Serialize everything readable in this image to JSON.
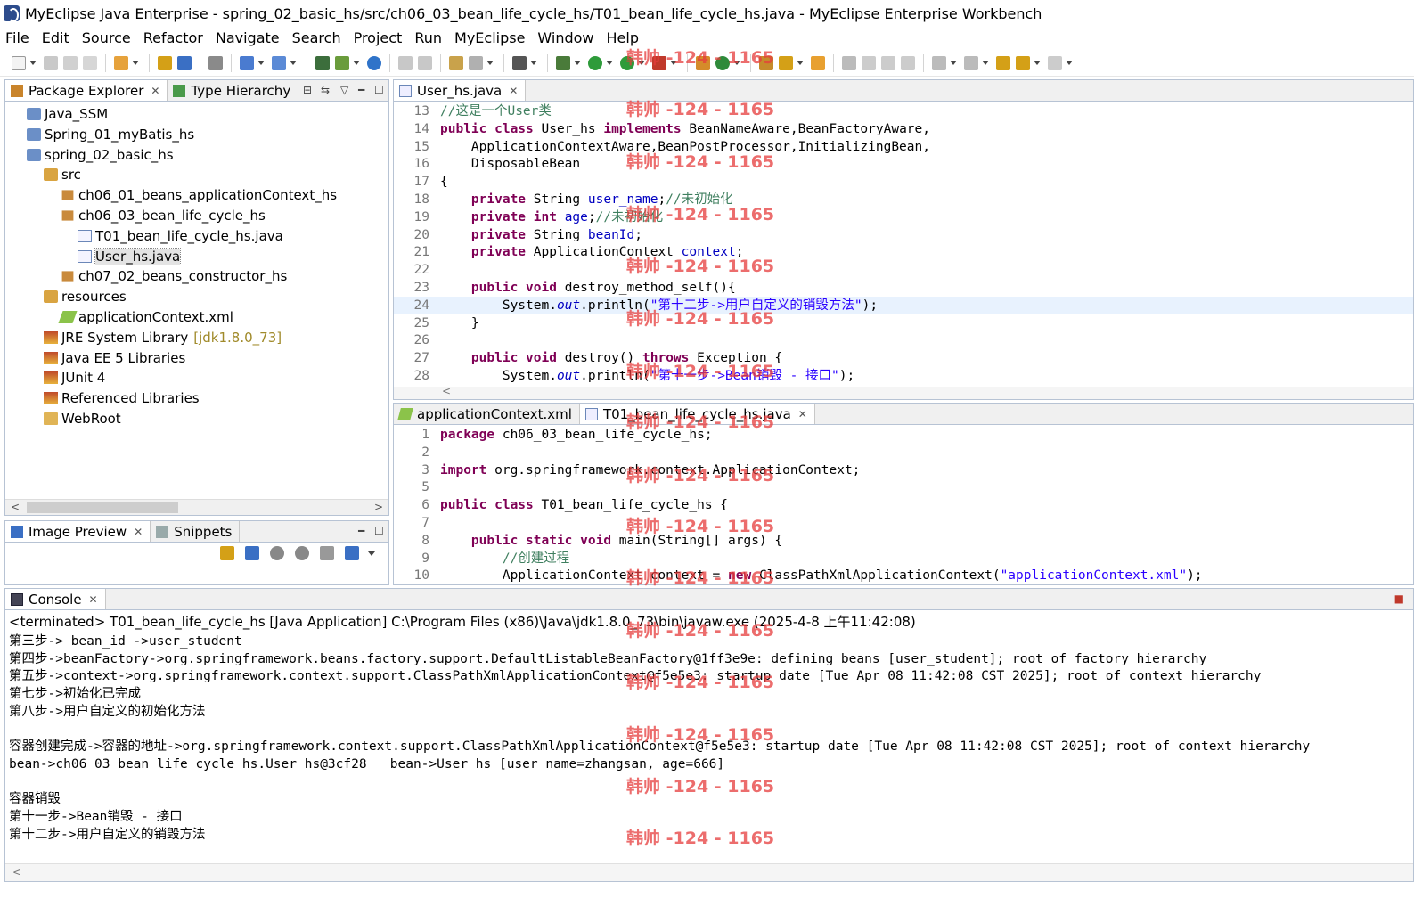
{
  "window": {
    "title": "MyEclipse Java Enterprise - spring_02_basic_hs/src/ch06_03_bean_life_cycle_hs/T01_bean_life_cycle_hs.java - MyEclipse Enterprise Workbench"
  },
  "menu": [
    "File",
    "Edit",
    "Source",
    "Refactor",
    "Navigate",
    "Search",
    "Project",
    "Run",
    "MyEclipse",
    "Window",
    "Help"
  ],
  "package_explorer": {
    "tab_label": "Package Explorer",
    "tab2_label": "Type Hierarchy",
    "items": [
      {
        "label": "Java_SSM",
        "depth": 1,
        "icon": "project-icon"
      },
      {
        "label": "Spring_01_myBatis_hs",
        "depth": 1,
        "icon": "project-icon"
      },
      {
        "label": "spring_02_basic_hs",
        "depth": 1,
        "icon": "project-icon"
      },
      {
        "label": "src",
        "depth": 2,
        "icon": "source-folder-icon"
      },
      {
        "label": "ch06_01_beans_applicationContext_hs",
        "depth": 3,
        "icon": "package-icon"
      },
      {
        "label": "ch06_03_bean_life_cycle_hs",
        "depth": 3,
        "icon": "package-icon"
      },
      {
        "label": "T01_bean_life_cycle_hs.java",
        "depth": 4,
        "icon": "java-file-icon"
      },
      {
        "label": "User_hs.java",
        "depth": 4,
        "icon": "java-file-icon",
        "selected": true
      },
      {
        "label": "ch07_02_beans_constructor_hs",
        "depth": 3,
        "icon": "package-icon"
      },
      {
        "label": "resources",
        "depth": 2,
        "icon": "source-folder-icon"
      },
      {
        "label": "applicationContext.xml",
        "depth": 3,
        "icon": "xml-file-icon"
      },
      {
        "label": "JRE System Library",
        "decor": "[jdk1.8.0_73]",
        "depth": 2,
        "icon": "library-icon"
      },
      {
        "label": "Java EE 5 Libraries",
        "depth": 2,
        "icon": "library-icon"
      },
      {
        "label": "JUnit 4",
        "depth": 2,
        "icon": "library-icon"
      },
      {
        "label": "Referenced Libraries",
        "depth": 2,
        "icon": "library-icon"
      },
      {
        "label": "WebRoot",
        "depth": 2,
        "icon": "folder-icon"
      }
    ]
  },
  "image_preview": {
    "tab_label": "Image Preview",
    "tab2_label": "Snippets"
  },
  "editor_top": {
    "tab_label": "User_hs.java",
    "lines": [
      {
        "n": "13",
        "parts": [
          [
            "cm",
            "//这是一个User类"
          ]
        ]
      },
      {
        "n": "14",
        "parts": [
          [
            "kw",
            "public class "
          ],
          [
            "",
            "User_hs "
          ],
          [
            "kw",
            "implements "
          ],
          [
            "",
            "BeanNameAware,BeanFactoryAware,"
          ]
        ]
      },
      {
        "n": "15",
        "parts": [
          [
            "",
            "    ApplicationContextAware,BeanPostProcessor,InitializingBean,"
          ]
        ]
      },
      {
        "n": "16",
        "parts": [
          [
            "",
            "    DisposableBean"
          ]
        ]
      },
      {
        "n": "17",
        "parts": [
          [
            "",
            "{"
          ]
        ]
      },
      {
        "n": "18",
        "parts": [
          [
            "",
            "    "
          ],
          [
            "kw",
            "private "
          ],
          [
            "",
            "String "
          ],
          [
            "fd",
            "user_name"
          ],
          [
            "",
            ";"
          ],
          [
            "cm",
            "//未初始化"
          ]
        ]
      },
      {
        "n": "19",
        "parts": [
          [
            "",
            "    "
          ],
          [
            "kw",
            "private int "
          ],
          [
            "fd",
            "age"
          ],
          [
            "",
            ";"
          ],
          [
            "cm",
            "//未初始化"
          ]
        ]
      },
      {
        "n": "20",
        "parts": [
          [
            "",
            "    "
          ],
          [
            "kw",
            "private "
          ],
          [
            "",
            "String "
          ],
          [
            "fd",
            "beanId"
          ],
          [
            "",
            ";"
          ]
        ]
      },
      {
        "n": "21",
        "parts": [
          [
            "",
            "    "
          ],
          [
            "kw",
            "private "
          ],
          [
            "",
            "ApplicationContext "
          ],
          [
            "fd",
            "context"
          ],
          [
            "",
            ";"
          ]
        ]
      },
      {
        "n": "22",
        "parts": [
          [
            "",
            ""
          ]
        ]
      },
      {
        "n": "23",
        "parts": [
          [
            "",
            "    "
          ],
          [
            "kw",
            "public void "
          ],
          [
            "",
            "destroy_method_self(){"
          ]
        ]
      },
      {
        "n": "24",
        "parts": [
          [
            "",
            "        System."
          ],
          [
            "it",
            "out"
          ],
          [
            "",
            ".println("
          ],
          [
            "st",
            "\"第十二步->用户自定义的销毁方法\""
          ],
          [
            "",
            ");"
          ]
        ],
        "highlight": true
      },
      {
        "n": "25",
        "parts": [
          [
            "",
            "    }"
          ]
        ]
      },
      {
        "n": "26",
        "parts": [
          [
            "",
            ""
          ]
        ]
      },
      {
        "n": "27",
        "parts": [
          [
            "",
            "    "
          ],
          [
            "kw",
            "public void "
          ],
          [
            "",
            "destroy() "
          ],
          [
            "kw",
            "throws "
          ],
          [
            "",
            "Exception {"
          ]
        ]
      },
      {
        "n": "28",
        "parts": [
          [
            "",
            "        System."
          ],
          [
            "it",
            "out"
          ],
          [
            "",
            ".println("
          ],
          [
            "st",
            "\"第十一步->Bean销毁 - 接口\""
          ],
          [
            "",
            ");"
          ]
        ]
      }
    ]
  },
  "editor_bottom": {
    "tab1_label": "applicationContext.xml",
    "tab2_label": "T01_bean_life_cycle_hs.java",
    "lines": [
      {
        "n": "1",
        "parts": [
          [
            "kw",
            "package "
          ],
          [
            "",
            "ch06_03_bean_life_cycle_hs;"
          ]
        ]
      },
      {
        "n": "2",
        "parts": [
          [
            "",
            ""
          ]
        ]
      },
      {
        "n": "3",
        "parts": [
          [
            "kw",
            "import "
          ],
          [
            "",
            "org.springframework.context.ApplicationContext;"
          ]
        ]
      },
      {
        "n": "5",
        "parts": [
          [
            "",
            ""
          ]
        ]
      },
      {
        "n": "6",
        "parts": [
          [
            "kw",
            "public class "
          ],
          [
            "",
            "T01_bean_life_cycle_hs {"
          ]
        ]
      },
      {
        "n": "7",
        "parts": [
          [
            "",
            ""
          ]
        ]
      },
      {
        "n": "8",
        "parts": [
          [
            "",
            "    "
          ],
          [
            "kw",
            "public static void "
          ],
          [
            "",
            "main(String[] args) {"
          ]
        ]
      },
      {
        "n": "9",
        "parts": [
          [
            "",
            "        "
          ],
          [
            "cm",
            "//创建过程"
          ]
        ]
      },
      {
        "n": "10",
        "parts": [
          [
            "",
            "        ApplicationContext context = "
          ],
          [
            "kw",
            "new "
          ],
          [
            "",
            "ClassPathXmlApplicationContext("
          ],
          [
            "st",
            "\"applicationContext.xml\""
          ],
          [
            "",
            ");"
          ]
        ]
      }
    ]
  },
  "console": {
    "tab_label": "Console",
    "header": "<terminated> T01_bean_life_cycle_hs [Java Application] C:\\Program Files (x86)\\Java\\jdk1.8.0_73\\bin\\javaw.exe (2025-4-8 上午11:42:08)",
    "lines": [
      "第三步-> bean_id ->user_student",
      "第四步->beanFactory->org.springframework.beans.factory.support.DefaultListableBeanFactory@1ff3e9e: defining beans [user_student]; root of factory hierarchy",
      "第五步->context->org.springframework.context.support.ClassPathXmlApplicationContext@f5e5e3: startup date [Tue Apr 08 11:42:08 CST 2025]; root of context hierarchy",
      "第七步->初始化已完成",
      "第八步->用户自定义的初始化方法",
      "",
      "容器创建完成->容器的地址->org.springframework.context.support.ClassPathXmlApplicationContext@f5e5e3: startup date [Tue Apr 08 11:42:08 CST 2025]; root of context hierarchy",
      "bean->ch06_03_bean_life_cycle_hs.User_hs@3cf28   bean->User_hs [user_name=zhangsan, age=666]",
      "",
      "容器销毁",
      "第十一步->Bean销毁 - 接口",
      "第十二步->用户自定义的销毁方法"
    ]
  },
  "watermark": "韩帅 -124 - 1165",
  "colors": {
    "keyword": "#7f0055",
    "comment": "#3f7f5f",
    "string": "#2a00ff",
    "field": "#0000c0",
    "watermark": "#e63c3c"
  }
}
